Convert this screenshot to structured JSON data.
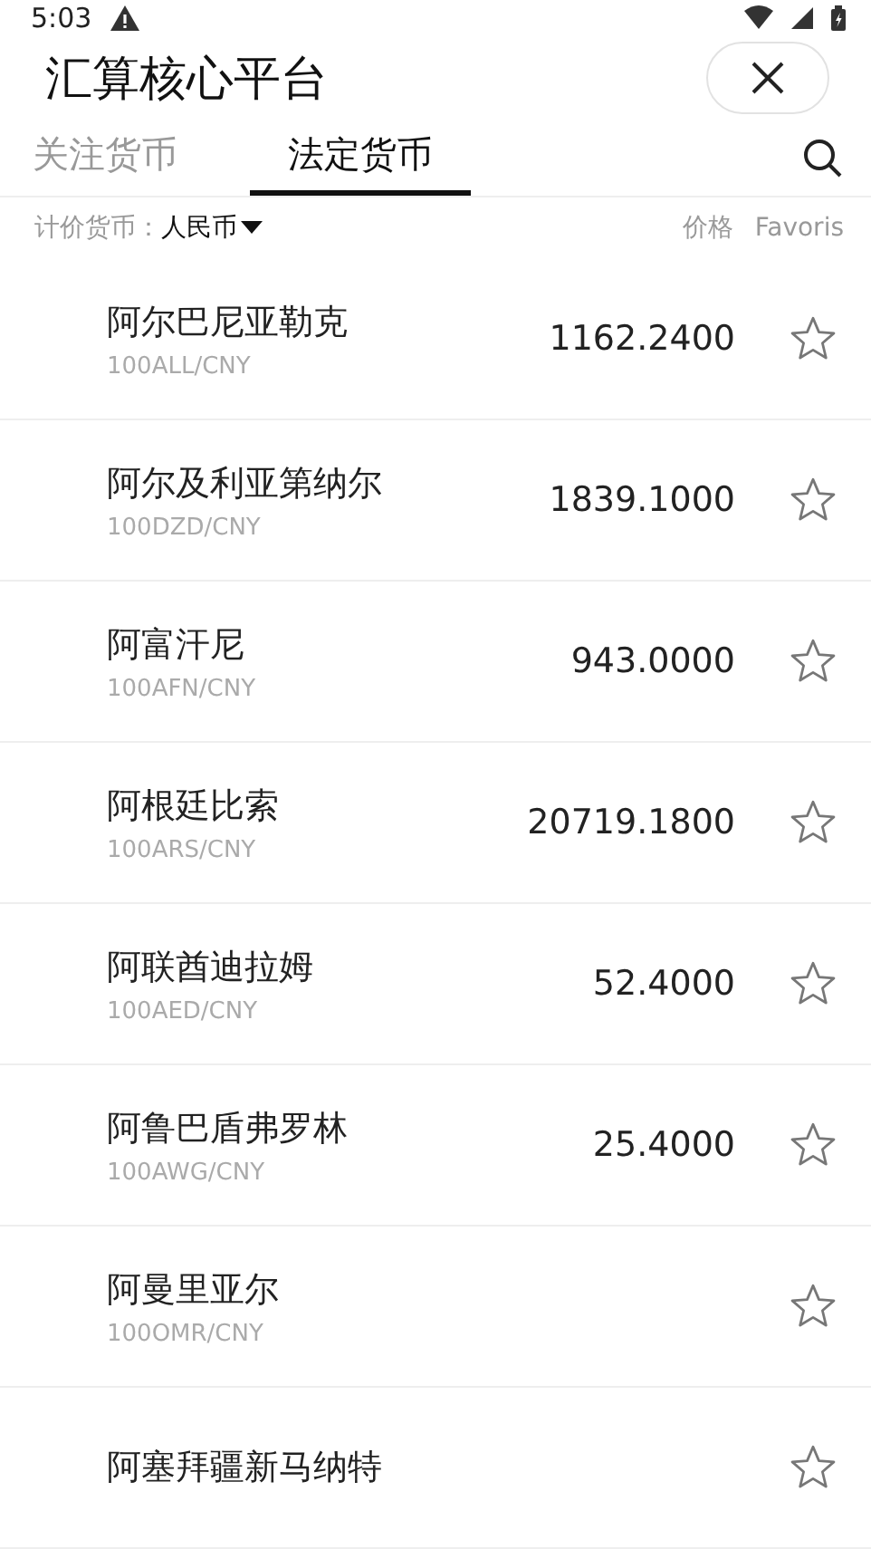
{
  "status_bar": {
    "time": "5:03"
  },
  "header": {
    "title": "汇算核心平台"
  },
  "tabs": [
    {
      "label": "关注货币",
      "selected": false
    },
    {
      "label": "法定货币",
      "selected": true
    }
  ],
  "filter": {
    "label": "计价货币：",
    "currency": "人民币",
    "price_header": "价格",
    "favorites_header": "Favoris"
  },
  "rows": [
    {
      "name": "阿尔巴尼亚勒克",
      "code": "100ALL/CNY",
      "price": "1162.2400",
      "favorite": false
    },
    {
      "name": "阿尔及利亚第纳尔",
      "code": "100DZD/CNY",
      "price": "1839.1000",
      "favorite": false
    },
    {
      "name": "阿富汗尼",
      "code": "100AFN/CNY",
      "price": "943.0000",
      "favorite": false
    },
    {
      "name": "阿根廷比索",
      "code": "100ARS/CNY",
      "price": "20719.1800",
      "favorite": false
    },
    {
      "name": "阿联酋迪拉姆",
      "code": "100AED/CNY",
      "price": "52.4000",
      "favorite": false
    },
    {
      "name": "阿鲁巴盾弗罗林",
      "code": "100AWG/CNY",
      "price": "25.4000",
      "favorite": false
    },
    {
      "name": "阿曼里亚尔",
      "code": "100OMR/CNY",
      "favorite": false
    },
    {
      "name": "阿塞拜疆新马纳特",
      "favorite": false
    }
  ]
}
